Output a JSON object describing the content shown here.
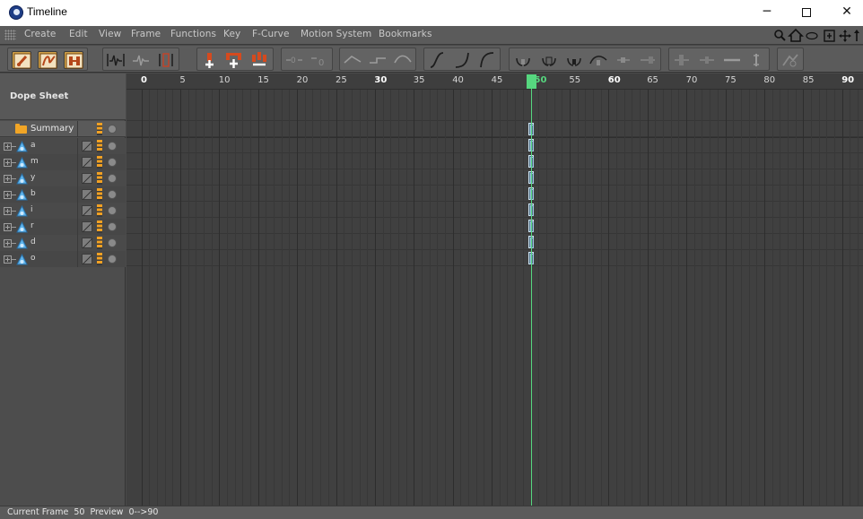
{
  "window": {
    "title": "Timeline",
    "controls": {
      "minimize": "─",
      "maximize": "□",
      "close": "✕"
    }
  },
  "menu": {
    "items": [
      "Create",
      "Edit",
      "View",
      "Frame",
      "Functions",
      "Key",
      "F-Curve",
      "Motion System",
      "Bookmarks"
    ],
    "right_icons": [
      "search-icon",
      "home-icon",
      "fit-icon",
      "frame-all-icon",
      "move-icon",
      "arrow-icon"
    ]
  },
  "toolbar": {
    "groups": [
      {
        "name": "mode-group",
        "buttons": [
          "key-mode-icon",
          "fcurve-mode-icon",
          "motion-mode-icon"
        ]
      },
      {
        "name": "view-group",
        "buttons": [
          "waveform-icon",
          "pulse-icon",
          "range-icon"
        ]
      },
      {
        "name": "key-add-group",
        "buttons": [
          "add-key-icon",
          "add-keys-icon",
          "remove-key-icon"
        ]
      },
      {
        "name": "zero-group",
        "buttons": [
          "zero-angle-icon",
          "zero-length-icon"
        ]
      },
      {
        "name": "interp-group",
        "buttons": [
          "linear-icon",
          "step-icon",
          "spline-icon"
        ]
      },
      {
        "name": "ease-group",
        "buttons": [
          "ease-inout-icon",
          "ease-in-icon",
          "ease-out-icon"
        ]
      },
      {
        "name": "tangent-group",
        "buttons": [
          "tangent-break-icon",
          "tangent-lock-icon",
          "tangent-auto-icon",
          "tangent-clamp-icon",
          "tangent-weight-icon"
        ]
      },
      {
        "name": "value-group",
        "buttons": [
          "lock-value-icon",
          "lock-time-icon",
          "flat-icon",
          "limit-icon"
        ]
      },
      {
        "name": "extra-group",
        "buttons": [
          "breakdown-icon"
        ]
      }
    ]
  },
  "dope_sheet": {
    "label": "Dope Sheet",
    "summary_label": "Summary",
    "tracks": [
      "a",
      "m",
      "y",
      "b",
      "i",
      "r",
      "d",
      "o"
    ]
  },
  "timeline": {
    "ruler_labels": [
      {
        "frame": 0,
        "text": "0",
        "major": true
      },
      {
        "frame": 5,
        "text": "5",
        "major": false
      },
      {
        "frame": 10,
        "text": "10",
        "major": false
      },
      {
        "frame": 15,
        "text": "15",
        "major": false
      },
      {
        "frame": 20,
        "text": "20",
        "major": false
      },
      {
        "frame": 25,
        "text": "25",
        "major": false
      },
      {
        "frame": 30,
        "text": "30",
        "major": true
      },
      {
        "frame": 35,
        "text": "35",
        "major": false
      },
      {
        "frame": 40,
        "text": "40",
        "major": false
      },
      {
        "frame": 45,
        "text": "45",
        "major": false
      },
      {
        "frame": 50,
        "text": "50",
        "major": false
      },
      {
        "frame": 55,
        "text": "55",
        "major": false
      },
      {
        "frame": 60,
        "text": "60",
        "major": true
      },
      {
        "frame": 65,
        "text": "65",
        "major": false
      },
      {
        "frame": 70,
        "text": "70",
        "major": false
      },
      {
        "frame": 75,
        "text": "75",
        "major": false
      },
      {
        "frame": 80,
        "text": "80",
        "major": false
      },
      {
        "frame": 85,
        "text": "85",
        "major": false
      },
      {
        "frame": 90,
        "text": "90",
        "major": true
      }
    ],
    "current_frame": 50,
    "key_frame": 50,
    "playhead_color": "#56d77f"
  },
  "status": {
    "text": "Current Frame  50  Preview  0-->90"
  }
}
